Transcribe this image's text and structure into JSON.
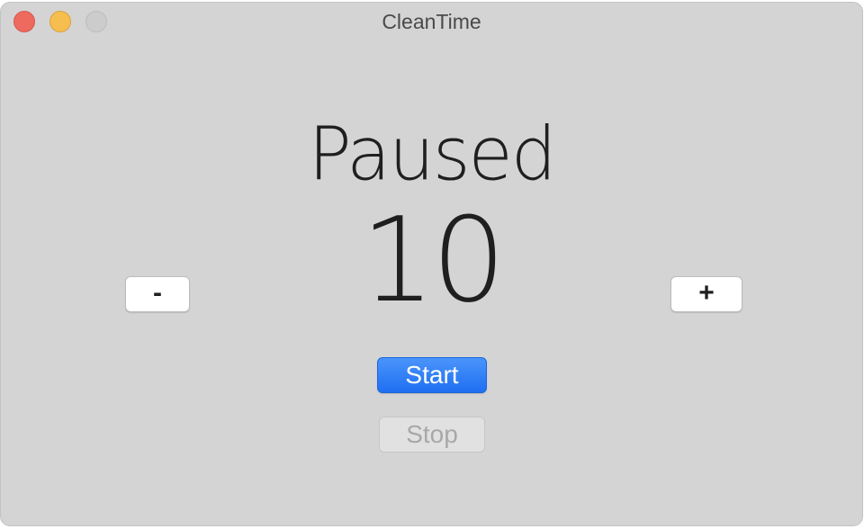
{
  "window": {
    "title": "CleanTime"
  },
  "timer": {
    "status": "Paused",
    "count": "10"
  },
  "controls": {
    "decrement_label": "-",
    "increment_label": "+",
    "start_label": "Start",
    "stop_label": "Stop",
    "stop_enabled": false
  },
  "colors": {
    "accent": "#1f6ff2",
    "close": "#ee6a5e",
    "minimize": "#f5be4f",
    "zoom_disabled": "#cdcccd"
  }
}
